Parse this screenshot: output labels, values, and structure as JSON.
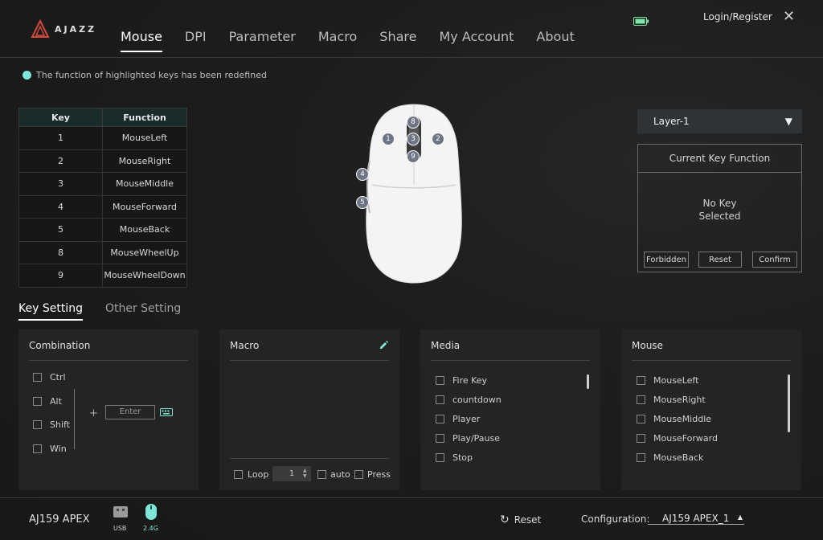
{
  "header": {
    "brand": "AJAZZ",
    "tabs": [
      "Mouse",
      "DPI",
      "Parameter",
      "Macro",
      "Share",
      "My Account",
      "About"
    ],
    "active_tab": "Mouse",
    "login": "Login/Register",
    "close": "✕"
  },
  "notice": "The function of highlighted keys has been redefined",
  "key_table": {
    "headers": [
      "Key",
      "Function"
    ],
    "rows": [
      [
        "1",
        "MouseLeft"
      ],
      [
        "2",
        "MouseRight"
      ],
      [
        "3",
        "MouseMiddle"
      ],
      [
        "4",
        "MouseForward"
      ],
      [
        "5",
        "MouseBack"
      ],
      [
        "8",
        "MouseWheelUp"
      ],
      [
        "9",
        "MouseWheelDown"
      ]
    ]
  },
  "mouse_badges": [
    "1",
    "2",
    "3",
    "4",
    "5",
    "8",
    "9"
  ],
  "layer": {
    "value": "Layer-1",
    "arrow": "▼"
  },
  "current_key": {
    "title": "Current Key Function",
    "line1": "No Key",
    "line2": "Selected",
    "forbidden": "Forbidden",
    "reset": "Reset",
    "confirm": "Confirm"
  },
  "subtabs": {
    "key_setting": "Key Setting",
    "other_setting": "Other Setting"
  },
  "combination": {
    "title": "Combination",
    "modifiers": [
      "Ctrl",
      "Alt",
      "Shift",
      "Win"
    ],
    "plus": "+",
    "enter_placeholder": "Enter"
  },
  "macro": {
    "title": "Macro",
    "loop": "Loop",
    "loop_value": "1",
    "auto": "auto",
    "press": "Press"
  },
  "media": {
    "title": "Media",
    "items": [
      "Fire Key",
      "countdown",
      "Player",
      "Play/Pause",
      "Stop"
    ]
  },
  "mouse_panel": {
    "title": "Mouse",
    "items": [
      "MouseLeft",
      "MouseRight",
      "MouseMiddle",
      "MouseForward",
      "MouseBack"
    ]
  },
  "bottom": {
    "device": "AJ159 APEX",
    "usb": "USB",
    "wireless": "2.4G",
    "reset": "Reset",
    "config_label": "Configuration:",
    "config_value": "AJ159 APEX_1"
  },
  "colors": {
    "accent": "#7ee6d6",
    "badge": "#6e7585",
    "panel": "#242424"
  }
}
